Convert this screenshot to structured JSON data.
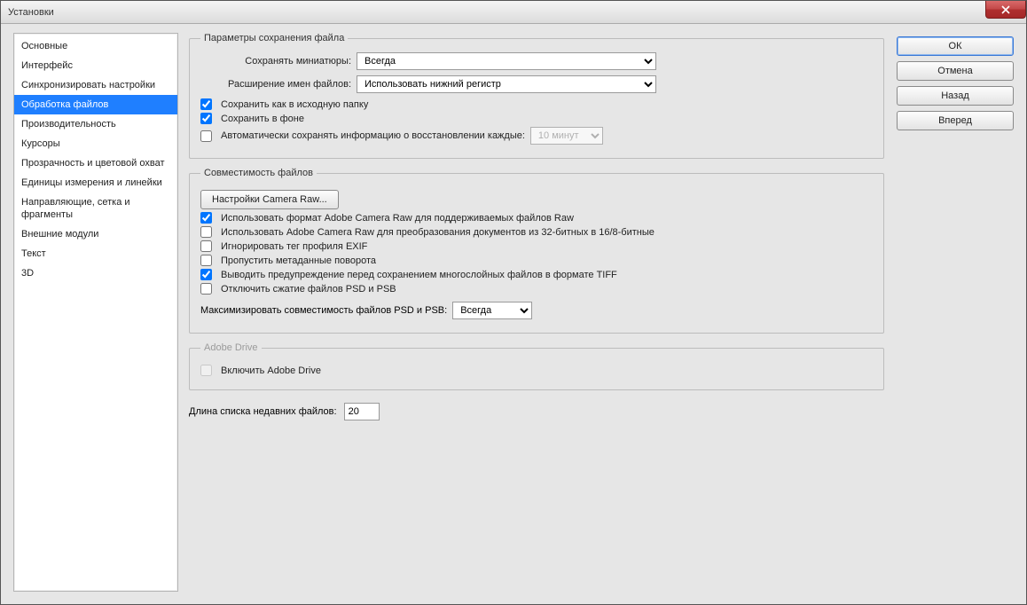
{
  "window": {
    "title": "Установки"
  },
  "sidebar": {
    "items": [
      "Основные",
      "Интерфейс",
      "Синхронизировать настройки",
      "Обработка файлов",
      "Производительность",
      "Курсоры",
      "Прозрачность и цветовой охват",
      "Единицы измерения и линейки",
      "Направляющие, сетка и фрагменты",
      "Внешние модули",
      "Текст",
      "3D"
    ],
    "selected_index": 3
  },
  "buttons": {
    "ok": "ОК",
    "cancel": "Отмена",
    "back": "Назад",
    "forward": "Вперед"
  },
  "group_save": {
    "legend": "Параметры сохранения файла",
    "thumbnails_label": "Сохранять миниатюры:",
    "thumbnails_value": "Всегда",
    "extension_label": "Расширение имен файлов:",
    "extension_value": "Использовать нижний регистр",
    "save_original_folder": "Сохранить как в исходную папку",
    "save_background": "Сохранить в фоне",
    "auto_save": "Автоматически сохранять информацию о восстановлении каждые:",
    "auto_save_interval": "10 минут"
  },
  "group_compat": {
    "legend": "Совместимость файлов",
    "camera_raw_btn": "Настройки Camera Raw...",
    "use_acr_raw": "Использовать формат Adobe Camera Raw для поддерживаемых файлов Raw",
    "use_acr_convert": "Использовать Adobe Camera Raw для преобразования документов из 32-битных в 16/8-битные",
    "ignore_exif": "Игнорировать тег профиля EXIF",
    "skip_rotation": "Пропустить метаданные поворота",
    "warn_tiff": "Выводить предупреждение перед сохранением многослойных файлов в формате TIFF",
    "disable_psd_compress": "Отключить сжатие файлов PSD и PSB",
    "maximize_label": "Максимизировать совместимость файлов PSD и PSB:",
    "maximize_value": "Всегда"
  },
  "group_drive": {
    "legend": "Adobe Drive",
    "enable_drive": "Включить Adobe Drive"
  },
  "recent": {
    "label": "Длина списка недавних файлов:",
    "value": "20"
  }
}
